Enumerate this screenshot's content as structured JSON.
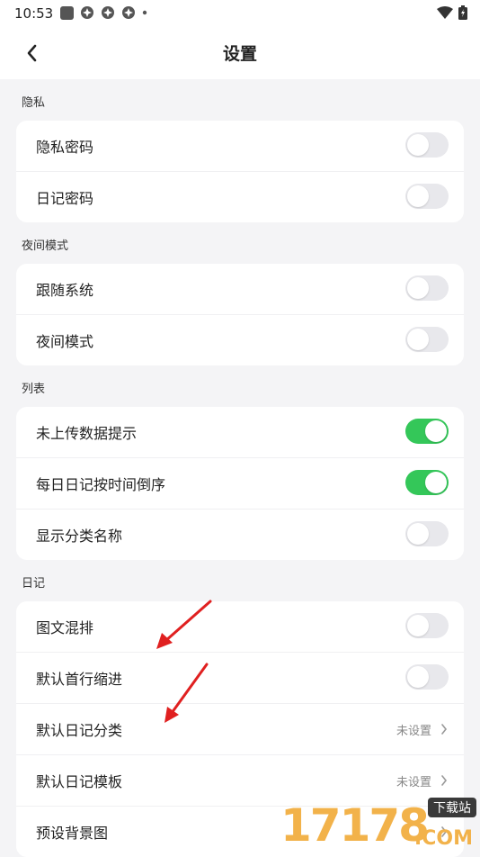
{
  "status_bar": {
    "time": "10:53",
    "icons": [
      "square-icon",
      "pinwheel-icon",
      "pinwheel-icon",
      "pinwheel-icon",
      "dot-icon"
    ],
    "right_icons": [
      "wifi-icon",
      "battery-icon"
    ]
  },
  "header": {
    "title": "设置",
    "back_icon": "chevron-left-icon"
  },
  "sections": [
    {
      "label": "隐私",
      "rows": [
        {
          "label": "隐私密码",
          "toggle": false
        },
        {
          "label": "日记密码",
          "toggle": false
        }
      ]
    },
    {
      "label": "夜间模式",
      "rows": [
        {
          "label": "跟随系统",
          "toggle": false
        },
        {
          "label": "夜间模式",
          "toggle": false
        }
      ]
    },
    {
      "label": "列表",
      "rows": [
        {
          "label": "未上传数据提示",
          "toggle": true
        },
        {
          "label": "每日日记按时间倒序",
          "toggle": true
        },
        {
          "label": "显示分类名称",
          "toggle": false
        }
      ]
    },
    {
      "label": "日记",
      "rows": [
        {
          "label": "图文混排",
          "toggle": false
        },
        {
          "label": "默认首行缩进",
          "toggle": false
        },
        {
          "label": "默认日记分类",
          "value": "未设置"
        },
        {
          "label": "默认日记模板",
          "value": "未设置"
        },
        {
          "label": "预设背景图"
        }
      ]
    }
  ],
  "colors": {
    "toggle_on": "#34c759",
    "toggle_off": "#e8e8ec",
    "annotation_arrow": "#e02020",
    "watermark": "#f2b24a"
  },
  "watermark": {
    "digits": "17178",
    "badge": "下载站",
    "suffix": ".COM"
  }
}
